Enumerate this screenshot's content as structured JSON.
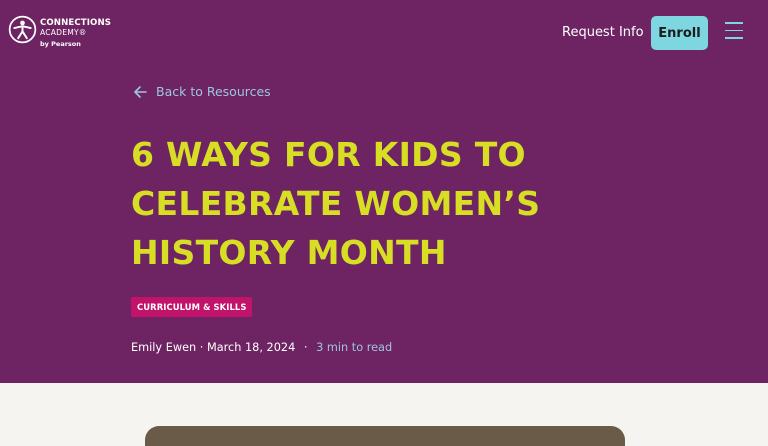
{
  "brand": {
    "line1": "CONNECTIONS",
    "line2": "ACADEMY®",
    "line3": "by Pearson"
  },
  "nav": {
    "request_info": "Request Info",
    "enroll": "Enroll",
    "menu_icon": "hamburger-icon"
  },
  "back_link": {
    "label": "Back to Resources",
    "icon": "arrow-left-icon"
  },
  "article": {
    "title": "6 Ways for Kids to Celebrate Women’s History Month",
    "category": "CURRICULUM & SKILLS",
    "author": "Emily Ewen",
    "date": "March 18, 2024",
    "separator": "·",
    "read_time": "3 min to read"
  },
  "colors": {
    "hero_bg": "#6e2462",
    "title": "#d7de24",
    "accent": "#7dd6e0",
    "tag_bg": "#c2136a",
    "link": "#9cc6dc",
    "page_bg": "#f6f4f1"
  }
}
